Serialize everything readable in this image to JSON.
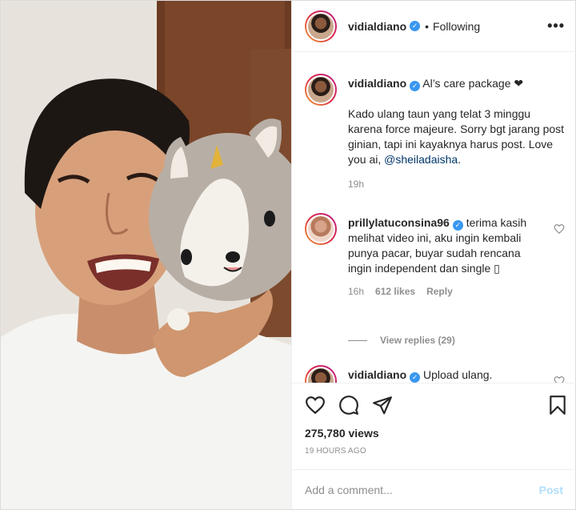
{
  "post": {
    "username": "vidialdiano",
    "follow_status": "Following",
    "separator": "•",
    "more_label": "•••"
  },
  "caption": {
    "username": "vidialdiano",
    "title": "Al’s care package ❤",
    "text": "Kado ulang taun yang telat 3 minggu karena force majeure. Sorry bgt jarang post ginian, tapi ini kayaknya harus post. Love you ai, ",
    "mention": "@sheiladaisha",
    "end": ".",
    "time": "19h"
  },
  "comments": [
    {
      "username": "prillylatuconsina96",
      "text": "terima kasih melihat video ini, aku ingin kembali punya pacar, buyar sudah rencana ingin independent dan single ▯",
      "time": "16h",
      "likes": "612 likes",
      "reply_label": "Reply",
      "view_replies": "View replies (29)"
    },
    {
      "username": "vidialdiano",
      "text": "Upload ulang."
    }
  ],
  "stats": {
    "views": "275,780 views",
    "posted": "19 HOURS AGO"
  },
  "composer": {
    "placeholder": "Add a comment...",
    "post_label": "Post"
  },
  "icons": {
    "verified": "verified-badge-icon",
    "like": "heart-icon",
    "comment": "comment-icon",
    "share": "share-icon",
    "save": "bookmark-icon",
    "more": "more-options-icon"
  },
  "colors": {
    "verified": "#3897f0",
    "mention": "#00376b",
    "muted": "#8e8e8e",
    "post_disabled": "#b2dffc"
  }
}
